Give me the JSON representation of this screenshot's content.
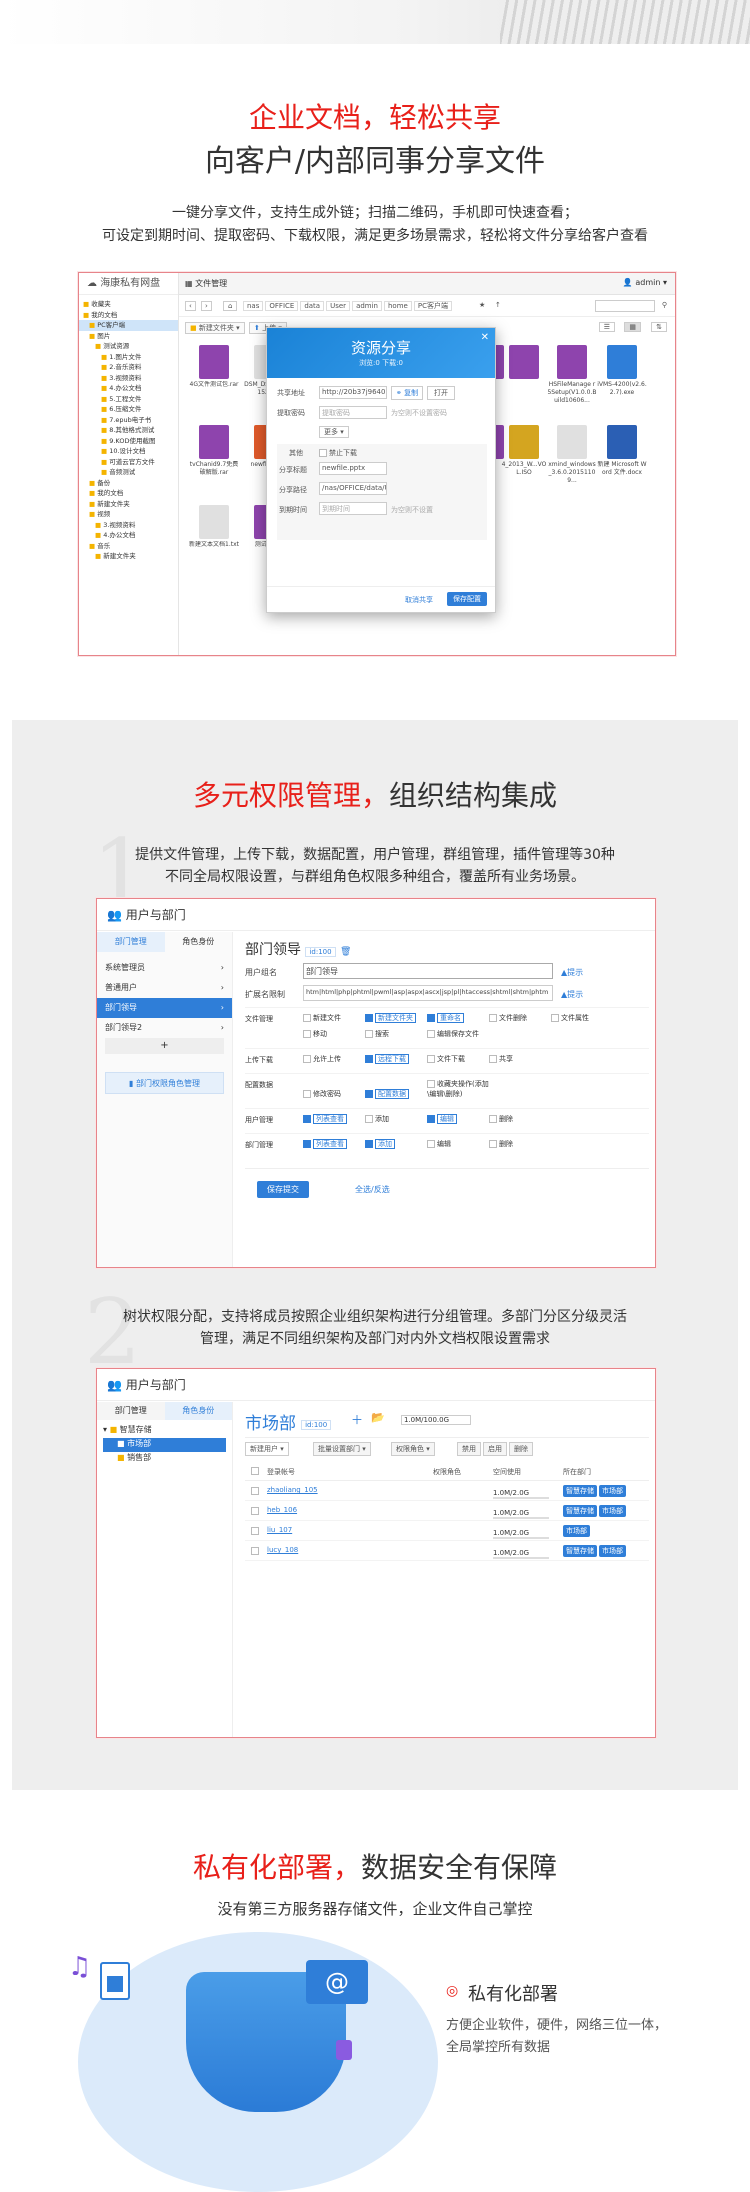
{
  "section1": {
    "title_red": "企业文档，轻松共享",
    "title_dark": "向客户/内部同事分享文件",
    "desc1": "一键分享文件，支持生成外链；扫描二维码，手机即可快速查看；",
    "desc2": "可设定到期时间、提取密码、下载权限，满足更多场景需求，轻松将文件分享给客户查看",
    "app": {
      "logo": "海康私有网盘",
      "tab": "文件管理",
      "user": "admin",
      "path": [
        "nas",
        "OFFICE",
        "data",
        "User",
        "admin",
        "home",
        "PC客户端"
      ],
      "new_folder": "新建文件夹",
      "upload": "上传",
      "tree": [
        "收藏夹",
        "我的文档",
        "PC客户端",
        "图片",
        "测试资源",
        "1.图片文件",
        "2.音乐资料",
        "3.视频资料",
        "4.办公文档",
        "5.工程文件",
        "6.压缩文件",
        "7.epub电子书",
        "8.其他格式测试",
        "9.KOD使用截图",
        "10.设计文档",
        "可道云官方文件",
        "音频测试",
        "备份",
        "我的文档",
        "新建文件夹",
        "视频",
        "3.视频资料",
        "4.办公文档",
        "音乐",
        "新建文件夹"
      ],
      "files": [
        "4G文件测试包.rar",
        "DSM_DS115...15152.pat",
        "",
        "",
        "HSFileManage r5Setup(V1.0.0.Build10606...",
        "iVMS-4200(v2.6.2.7).exe",
        "tvChanid9.7免费破解版.rar",
        "newfile.pptx",
        "",
        "4_2013_W...VOL.ISO",
        "xmind_windows_3.6.0.20151109...",
        "新建 Microsoft Word 文件.docx",
        "新建文本文档1.txt",
        "测试包.rar"
      ]
    },
    "dialog": {
      "title": "资源分享",
      "subtitle": "浏览:0  下载:0",
      "share_addr_label": "共享地址",
      "share_addr": "http://20b37j9640.iok.la:2...",
      "copy": "复制",
      "open": "打开",
      "code_label": "提取密码",
      "code_ph": "提取密码",
      "code_hint": "为空则不设置密码",
      "more": "更多",
      "other_label": "其他",
      "no_download": "禁止下载",
      "share_title_label": "分享标题",
      "share_title": "newfile.pptx",
      "share_path_label": "分享路径",
      "share_path": "/nas/OFFICE/data/User/a",
      "expire_label": "到期时间",
      "expire_ph": "到期时间",
      "expire_hint": "为空则不设置",
      "cancel": "取消共享",
      "save": "保存配置"
    }
  },
  "section2": {
    "title_red": "多元权限管理，",
    "title_dark": "组织结构集成",
    "desc1": "提供文件管理，上传下载，数据配置，用户管理，群组管理，插件管理等30种",
    "desc2": "不同全局权限设置，与群组角色权限多种组合，覆盖所有业务场景。",
    "panel": {
      "title": "用户与部门",
      "tab_dept": "部门管理",
      "tab_role": "角色身份",
      "roles": [
        "系统管理员",
        "普通用户",
        "部门领导",
        "部门领导2"
      ],
      "add": "+",
      "role_perm_btn": "部门权限角色管理",
      "role_title": "部门领导",
      "role_id": "id:100",
      "name_label": "用户组名",
      "name_value": "部门领导",
      "tip": "提示",
      "ext_label": "扩展名限制",
      "ext_value": "htm|html|php|phtml|pwml|asp|aspx|ascx|jsp|pl|htaccess|shtml|shtm|phtm",
      "tip2": "提示",
      "rows": [
        {
          "label": "文件管理",
          "items": [
            "新建文件",
            "新建文件夹",
            "重命名",
            "文件删除",
            "文件属性",
            "移动",
            "搜索",
            "编辑保存文件"
          ],
          "on": [
            false,
            true,
            true,
            false,
            false,
            false,
            false,
            false
          ]
        },
        {
          "label": "上传下载",
          "items": [
            "允许上传",
            "远程下载",
            "文件下载",
            "共享"
          ],
          "on": [
            false,
            true,
            false,
            false
          ]
        },
        {
          "label": "配置数据",
          "items": [
            "修改密码",
            "配置数据",
            "收藏夹操作(添加\\编辑\\删除)"
          ],
          "on": [
            false,
            true,
            false
          ]
        },
        {
          "label": "用户管理",
          "items": [
            "列表查看",
            "添加",
            "编辑",
            "删除"
          ],
          "on": [
            true,
            false,
            true,
            false
          ]
        },
        {
          "label": "部门管理",
          "items": [
            "列表查看",
            "添加",
            "编辑",
            "删除"
          ],
          "on": [
            true,
            true,
            false,
            false
          ]
        }
      ],
      "save": "保存提交",
      "toggle": "全选/反选"
    }
  },
  "section3": {
    "desc1": "树状权限分配，支持将成员按照企业组织架构进行分组管理。多部门分区分级灵活",
    "desc2": "管理，满足不同组织架构及部门对内外文档权限设置需求",
    "panel": {
      "title": "用户与部门",
      "tab_dept": "部门管理",
      "tab_role": "角色身份",
      "tree": [
        "智慧存储",
        "市场部",
        "销售部"
      ],
      "dept_title": "市场部",
      "dept_id": "id:100",
      "quota": "1.0M/100.0G",
      "new_user": "新建用户",
      "batch": "批量设置部门",
      "role": "权限角色",
      "disable": "禁用",
      "enable": "启用",
      "delete": "删除",
      "headers": [
        "登录帐号",
        "权限角色",
        "空间使用",
        "所在部门"
      ],
      "users": [
        {
          "name": "zhaoliang_105",
          "space": "1.0M/2.0G",
          "depts": [
            "智慧存储",
            "市场部"
          ]
        },
        {
          "name": "heb_106",
          "space": "1.0M/2.0G",
          "depts": [
            "智慧存储",
            "市场部"
          ]
        },
        {
          "name": "liu_107",
          "space": "1.0M/2.0G",
          "depts": [
            "市场部"
          ]
        },
        {
          "name": "lucy_108",
          "space": "1.0M/2.0G",
          "depts": [
            "智慧存储",
            "市场部"
          ]
        }
      ]
    }
  },
  "section4": {
    "title_red": "私有化部署，",
    "title_dark": "数据安全有保障",
    "desc": "没有第三方服务器存储文件，企业文件自己掌控",
    "feature_title": "私有化部署",
    "feature_desc1": "方便企业软件，硬件，网络三位一体，",
    "feature_desc2": "全局掌控所有数据"
  },
  "colors": {
    "accent_red": "#e8201a",
    "accent_blue": "#2f7ed8",
    "frame": "#e7848a"
  }
}
